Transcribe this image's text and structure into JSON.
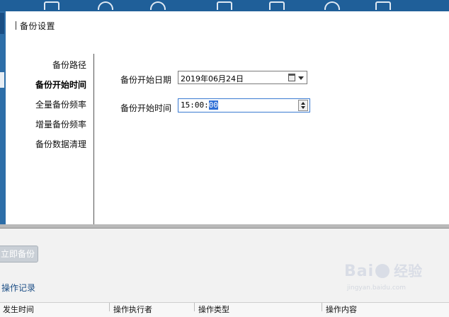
{
  "dialog": {
    "title": "备份设置"
  },
  "nav": {
    "items": [
      {
        "label": "备份路径",
        "active": false
      },
      {
        "label": "备份开始时间",
        "active": true
      },
      {
        "label": "全量备份频率",
        "active": false
      },
      {
        "label": "增量备份频率",
        "active": false
      },
      {
        "label": "备份数据清理",
        "active": false
      }
    ]
  },
  "form": {
    "start_date_label": "备份开始日期",
    "start_date_value": "2019年06月24日",
    "start_time_label": "备份开始时间",
    "start_time_prefix": "15:00:",
    "start_time_selected": "00"
  },
  "background": {
    "backup_now_label": "立即备份",
    "oplog_title": "操作记录",
    "table_headers": [
      "发生时间",
      "操作执行者",
      "操作类型",
      "操作内容"
    ]
  },
  "watermark": {
    "brand_a": "Bai",
    "brand_b": "经验",
    "url": "jingyan.baidu.com"
  },
  "colors": {
    "top_bar": "#1f5f99",
    "selection": "#2f6fd6",
    "link": "#1d4f86"
  }
}
